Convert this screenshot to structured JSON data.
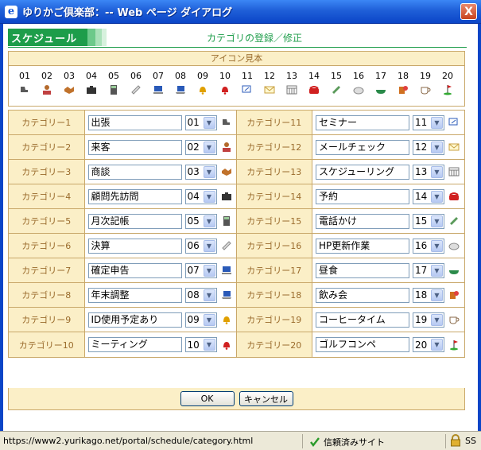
{
  "window": {
    "title": "ゆりかご倶楽部：-- Web ページ ダイアログ",
    "close_glyph": "X"
  },
  "header": {
    "section_label": "スケジュール",
    "page_title": "カテゴリの登録／修正"
  },
  "icon_sample": {
    "heading": "アイコン見本",
    "items": [
      {
        "num": "01",
        "icon": "shoe-icon",
        "color": "#5a5a5a"
      },
      {
        "num": "02",
        "icon": "person-icon",
        "color": "#b46a2c"
      },
      {
        "num": "03",
        "icon": "handshake-icon",
        "color": "#c0722c"
      },
      {
        "num": "04",
        "icon": "briefcase-icon",
        "color": "#333333"
      },
      {
        "num": "05",
        "icon": "calculator-icon",
        "color": "#555555"
      },
      {
        "num": "06",
        "icon": "pencil-check-icon",
        "color": "#8a8a8a"
      },
      {
        "num": "07",
        "icon": "computer-icon",
        "color": "#2a5ab8"
      },
      {
        "num": "08",
        "icon": "laptop-icon",
        "color": "#2a5ab8"
      },
      {
        "num": "09",
        "icon": "bell-icon",
        "color": "#e0a000"
      },
      {
        "num": "10",
        "icon": "alarm-bell-icon",
        "color": "#d02020"
      },
      {
        "num": "11",
        "icon": "presentation-icon",
        "color": "#2a5ab8"
      },
      {
        "num": "12",
        "icon": "envelope-icon",
        "color": "#c8a040"
      },
      {
        "num": "13",
        "icon": "calendar-icon",
        "color": "#777777"
      },
      {
        "num": "14",
        "icon": "phone-icon",
        "color": "#d02020"
      },
      {
        "num": "15",
        "icon": "handset-icon",
        "color": "#5a9a5a"
      },
      {
        "num": "16",
        "icon": "meal-icon",
        "color": "#8a8a8a"
      },
      {
        "num": "17",
        "icon": "bowl-icon",
        "color": "#2a8a4a"
      },
      {
        "num": "18",
        "icon": "drink-icon",
        "color": "#d07020"
      },
      {
        "num": "19",
        "icon": "coffee-icon",
        "color": "#8a6a4a"
      },
      {
        "num": "20",
        "icon": "golf-icon",
        "color": "#d02020"
      }
    ]
  },
  "categories": {
    "left": [
      {
        "label": "カテゴリー1",
        "name": "出張",
        "num": "01",
        "icon": "shoe-icon",
        "color": "#5a5a5a"
      },
      {
        "label": "カテゴリー2",
        "name": "来客",
        "num": "02",
        "icon": "person-icon",
        "color": "#b46a2c"
      },
      {
        "label": "カテゴリー3",
        "name": "商談",
        "num": "03",
        "icon": "handshake-icon",
        "color": "#c0722c"
      },
      {
        "label": "カテゴリー4",
        "name": "顧問先訪問",
        "num": "04",
        "icon": "briefcase-icon",
        "color": "#333333"
      },
      {
        "label": "カテゴリー5",
        "name": "月次記帳",
        "num": "05",
        "icon": "calculator-icon",
        "color": "#555555"
      },
      {
        "label": "カテゴリー6",
        "name": "決算",
        "num": "06",
        "icon": "pencil-check-icon",
        "color": "#8a8a8a"
      },
      {
        "label": "カテゴリー7",
        "name": "確定申告",
        "num": "07",
        "icon": "computer-icon",
        "color": "#2a5ab8"
      },
      {
        "label": "カテゴリー8",
        "name": "年末調整",
        "num": "08",
        "icon": "laptop-icon",
        "color": "#2a5ab8"
      },
      {
        "label": "カテゴリー9",
        "name": "ID使用予定あり",
        "num": "09",
        "icon": "bell-icon",
        "color": "#e0a000"
      },
      {
        "label": "カテゴリー10",
        "name": "ミーティング",
        "num": "10",
        "icon": "alarm-bell-icon",
        "color": "#d02020"
      }
    ],
    "right": [
      {
        "label": "カテゴリー11",
        "name": "セミナー",
        "num": "11",
        "icon": "presentation-icon",
        "color": "#2a5ab8"
      },
      {
        "label": "カテゴリー12",
        "name": "メールチェック",
        "num": "12",
        "icon": "envelope-icon",
        "color": "#c8a040"
      },
      {
        "label": "カテゴリー13",
        "name": "スケジューリング",
        "num": "13",
        "icon": "calendar-icon",
        "color": "#777777"
      },
      {
        "label": "カテゴリー14",
        "name": "予約",
        "num": "14",
        "icon": "phone-icon",
        "color": "#d02020"
      },
      {
        "label": "カテゴリー15",
        "name": "電話かけ",
        "num": "15",
        "icon": "handset-icon",
        "color": "#5a9a5a"
      },
      {
        "label": "カテゴリー16",
        "name": "HP更新作業",
        "num": "16",
        "icon": "meal-icon",
        "color": "#8a8a8a"
      },
      {
        "label": "カテゴリー17",
        "name": "昼食",
        "num": "17",
        "icon": "bowl-icon",
        "color": "#2a8a4a"
      },
      {
        "label": "カテゴリー18",
        "name": "飲み会",
        "num": "18",
        "icon": "drink-icon",
        "color": "#d07020"
      },
      {
        "label": "カテゴリー19",
        "name": "コーヒータイム",
        "num": "19",
        "icon": "coffee-icon",
        "color": "#8a6a4a"
      },
      {
        "label": "カテゴリー20",
        "name": "ゴルフコンペ",
        "num": "20",
        "icon": "golf-icon",
        "color": "#d02020"
      }
    ]
  },
  "buttons": {
    "ok": "OK",
    "cancel": "キャンセル"
  },
  "statusbar": {
    "url": "https://www2.yurikago.net/portal/schedule/category.html",
    "trusted": "信頼済みサイト",
    "ss": "SS"
  }
}
